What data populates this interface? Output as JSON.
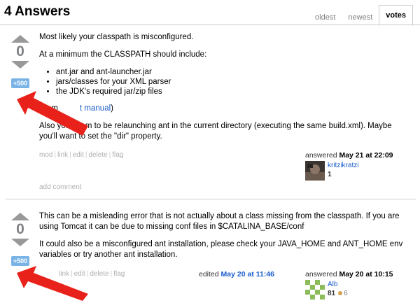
{
  "header": {
    "count_label": "4 Answers",
    "tabs": [
      {
        "label": "oldest"
      },
      {
        "label": "newest"
      },
      {
        "label": "votes"
      }
    ]
  },
  "answers": [
    {
      "vote_count": "0",
      "bounty": "+500",
      "p1": "Most likely your classpath is misconfigured.",
      "p2": "At a minimum the CLASSPATH should include:",
      "list": [
        "ant.jar and ant-launcher.jar",
        "jars/classes for your XML parser",
        "the JDK's required jar/zip files"
      ],
      "source_prefix": "(from",
      "source_link": "t manual",
      "source_suffix": ")",
      "p3": "Also you seem to be relaunching ant in the current directory (executing the same build.xml). Maybe you'll want to set the \"dir\" property.",
      "menu": [
        "mod",
        "link",
        "edit",
        "delete",
        "flag"
      ],
      "answered_label": "answered",
      "answered_date": "May 21 at 22:09",
      "user_name": "kritzikratzi",
      "user_rep": "1",
      "add_comment": "add comment"
    },
    {
      "vote_count": "0",
      "bounty": "+500",
      "p1": "This can be a misleading error that is not actually about a class missing from the classpath. If you are using Tomcat it can be due to missing conf files in $CATALINA_BASE/conf",
      "p2": "It could also be a misconfigured ant installation, please check your JAVA_HOME and ANT_HOME env variables or try another ant installation.",
      "menu": [
        "link",
        "edit",
        "delete",
        "flag"
      ],
      "edited_label": "edited",
      "edited_date": "May 20 at 11:46",
      "answered_label": "answered",
      "answered_date": "May 20 at 10:15",
      "user_name": "Alb",
      "user_rep": "81",
      "user_badges": "6"
    }
  ],
  "colors": {
    "arrow_annotation": "#e8221b",
    "link": "#1a5ccc",
    "bounty": "#7ab4e6"
  }
}
